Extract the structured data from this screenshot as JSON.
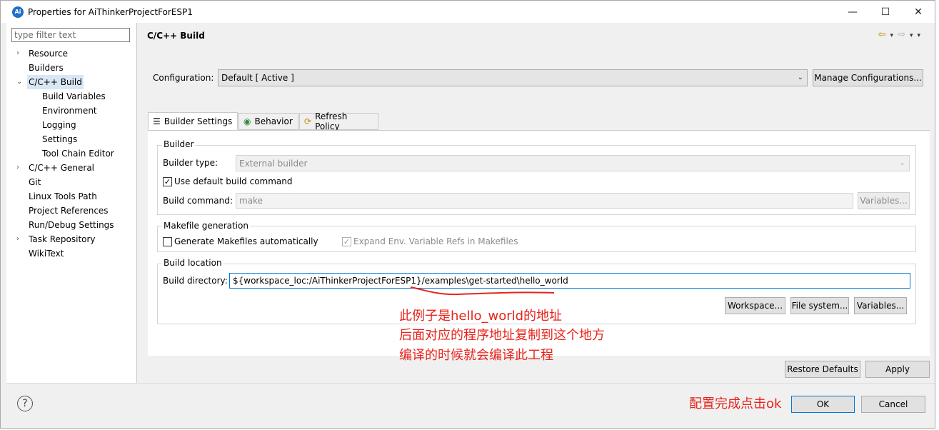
{
  "window": {
    "title": "Properties for AiThinkerProjectForESP1",
    "app_icon": "Ai",
    "minimize": "—",
    "maximize": "☐",
    "close": "✕"
  },
  "filter": {
    "placeholder": "type filter text"
  },
  "tree": [
    {
      "label": "Resource",
      "expander": "›"
    },
    {
      "label": "Builders",
      "expander": ""
    },
    {
      "label": "C/C++ Build",
      "expander": "⌄",
      "selected": true
    },
    {
      "label": "Build Variables",
      "child": true
    },
    {
      "label": "Environment",
      "child": true
    },
    {
      "label": "Logging",
      "child": true
    },
    {
      "label": "Settings",
      "child": true
    },
    {
      "label": "Tool Chain Editor",
      "child": true
    },
    {
      "label": "C/C++ General",
      "expander": "›"
    },
    {
      "label": "Git",
      "expander": ""
    },
    {
      "label": "Linux Tools Path",
      "expander": ""
    },
    {
      "label": "Project References",
      "expander": ""
    },
    {
      "label": "Run/Debug Settings",
      "expander": ""
    },
    {
      "label": "Task Repository",
      "expander": "›"
    },
    {
      "label": "WikiText",
      "expander": ""
    }
  ],
  "header": {
    "title": "C/C++ Build",
    "back": "⇦",
    "forward": "⇨",
    "dropdown": "▾"
  },
  "config": {
    "label": "Configuration:",
    "value": "Default  [ Active ]",
    "manage_button": "Manage Configurations..."
  },
  "tabs": [
    {
      "label": "Builder Settings",
      "icon": "☰"
    },
    {
      "label": "Behavior",
      "icon": "◉"
    },
    {
      "label": "Refresh Policy",
      "icon": "⟳"
    }
  ],
  "builder": {
    "group_title": "Builder",
    "type_label": "Builder type:",
    "type_value": "External builder",
    "use_default_label": "Use default build command",
    "use_default_checked": "✓",
    "command_label": "Build command:",
    "command_value": "make",
    "variables_button": "Variables..."
  },
  "makefile": {
    "group_title": "Makefile generation",
    "generate_label": "Generate Makefiles automatically",
    "expand_label": "Expand Env. Variable Refs in Makefiles",
    "expand_checked": "✓"
  },
  "location": {
    "group_title": "Build location",
    "dir_label": "Build directory:",
    "dir_value": "${workspace_loc:/AiThinkerProjectForESP1}/examples\\get-started\\hello_world",
    "workspace_button": "Workspace...",
    "filesystem_button": "File system...",
    "variables_button": "Variables..."
  },
  "annotation": {
    "line1": "此例子是hello_world的地址",
    "line2": "后面对应的程序地址复制到这个地方",
    "line3": "编译的时候就会编译此工程",
    "ok_note": "配置完成点击ok",
    "color": "#e8231c"
  },
  "buttons": {
    "restore": "Restore Defaults",
    "apply": "Apply",
    "ok": "OK",
    "cancel": "Cancel"
  },
  "help_icon": "?"
}
